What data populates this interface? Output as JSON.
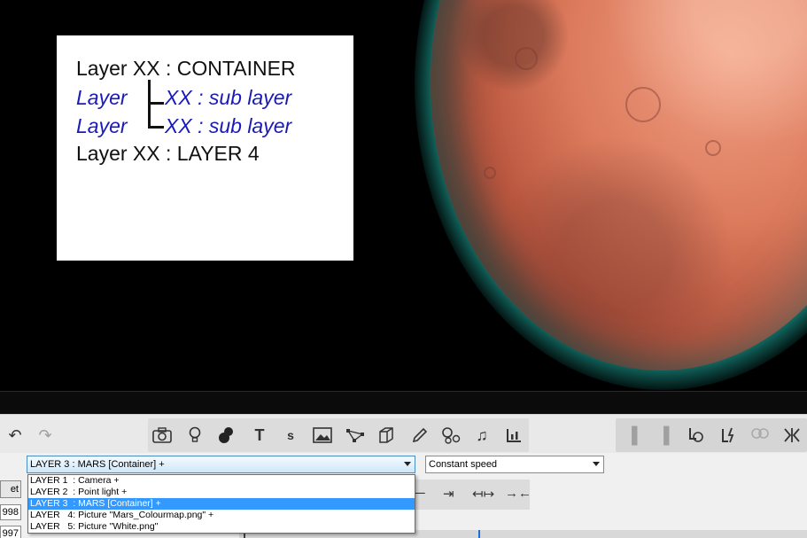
{
  "legend": {
    "line1": "Layer XX : CONTAINER",
    "line2_left": "Layer",
    "line2_right": "XX : sub layer",
    "line3_left": "Layer",
    "line3_right": "XX : sub layer",
    "line4": "Layer XX : LAYER 4"
  },
  "toolbar": {
    "tools": [
      "undo-icon",
      "redo-icon",
      "camera-icon",
      "light-bulb-icon",
      "blob-icon",
      "text-icon",
      "small-text-icon",
      "picture-icon",
      "path-icon",
      "cube-icon",
      "pencil-icon",
      "circles-icon",
      "music-note-icon",
      "chart-icon"
    ],
    "right_tools": [
      "link-icon",
      "link-alt-icon",
      "unlink-icon",
      "lightning-icon",
      "circle-chain-icon",
      "collapse-icon"
    ],
    "text_tool_label": "T",
    "small_text_tool_label": "s"
  },
  "layer_select": {
    "selected": "LAYER 3  : MARS [Container] +",
    "options": [
      "LAYER 1  : Camera +",
      "LAYER 2  : Point light +",
      "LAYER 3  : MARS [Container] +",
      "LAYER   4: Picture \"Mars_Colourmap.png\" +",
      "LAYER   5: Picture \"White.png\""
    ],
    "highlighted_index": 2
  },
  "speed_select": {
    "selected": "Constant speed"
  },
  "left_panel": {
    "button_label": "et",
    "field1": "998",
    "field2": "997"
  },
  "colors": {
    "accent": "#3399ff",
    "legend_blue": "#1a1ab8",
    "glow": "#1fb3a6"
  }
}
